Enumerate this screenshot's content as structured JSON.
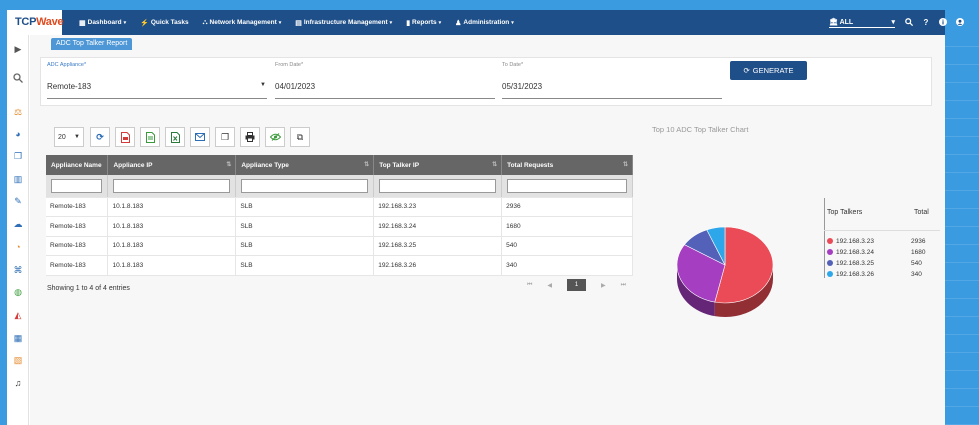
{
  "brand": {
    "name_prefix": "TCP",
    "name_suffix": "Wave"
  },
  "nav": [
    {
      "icon": "▦",
      "label": "Dashboard",
      "dropdown": true
    },
    {
      "icon": "⚡",
      "label": "Quick Tasks",
      "dropdown": false
    },
    {
      "icon": "⛬",
      "label": "Network Management",
      "dropdown": true
    },
    {
      "icon": "▤",
      "label": "Infrastructure Management",
      "dropdown": true
    },
    {
      "icon": "▮",
      "label": "Reports",
      "dropdown": true
    },
    {
      "icon": "♟",
      "label": "Administration",
      "dropdown": true
    }
  ],
  "org_selector": {
    "icon": "🏛",
    "value": "ALL"
  },
  "page": {
    "tab_label": "ADC Top Talker Report"
  },
  "filters": {
    "appliance": {
      "label": "ADC Appliance*",
      "value": "Remote-183"
    },
    "from_date": {
      "label": "From Date*",
      "value": "04/01/2023"
    },
    "to_date": {
      "label": "To Date*",
      "value": "05/31/2023"
    },
    "generate_label": "GENERATE"
  },
  "table": {
    "page_length": "20",
    "columns": [
      "Appliance Name",
      "Appliance IP",
      "Appliance Type",
      "Top Talker IP",
      "Total Requests"
    ],
    "rows": [
      [
        "Remote-183",
        "10.1.8.183",
        "SLB",
        "192.168.3.23",
        "2936"
      ],
      [
        "Remote-183",
        "10.1.8.183",
        "SLB",
        "192.168.3.24",
        "1680"
      ],
      [
        "Remote-183",
        "10.1.8.183",
        "SLB",
        "192.168.3.25",
        "540"
      ],
      [
        "Remote-183",
        "10.1.8.183",
        "SLB",
        "192.168.3.26",
        "340"
      ]
    ],
    "info": "Showing 1 to 4 of 4 entries",
    "pagination": {
      "first": "⏮",
      "prev": "◀",
      "current": "1",
      "next": "▶",
      "last": "⏭"
    }
  },
  "chart_data": {
    "type": "pie",
    "title": "Top 10 ADC Top Talker Chart",
    "legend_header": {
      "name": "Top Talkers",
      "total": "Total"
    },
    "categories": [
      "192.168.3.23",
      "192.168.3.24",
      "192.168.3.25",
      "192.168.3.26"
    ],
    "values": [
      2936,
      1680,
      540,
      340
    ],
    "colors": [
      "#ea4b56",
      "#a53ec0",
      "#5461b8",
      "#2ea6ea"
    ],
    "legend_placement": "right"
  }
}
